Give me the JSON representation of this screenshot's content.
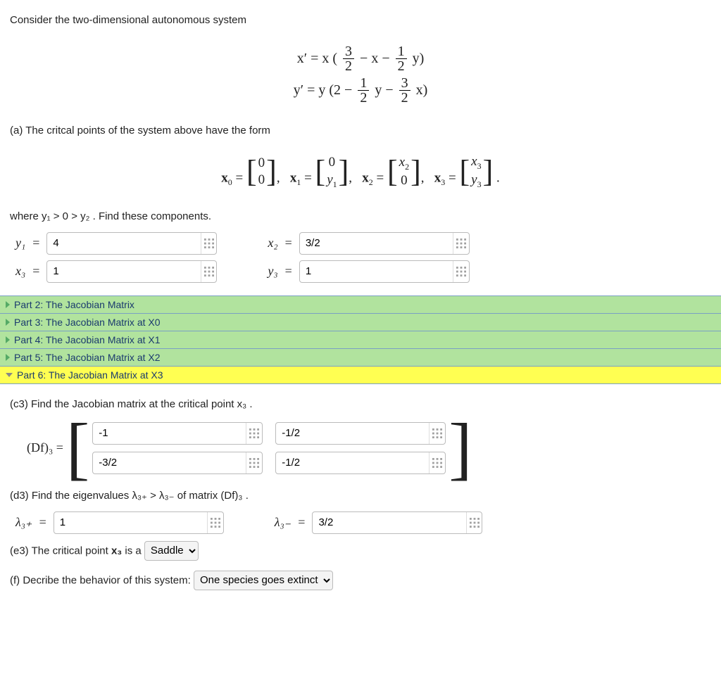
{
  "intro": "Consider the two-dimensional autonomous system",
  "equations": {
    "row1": {
      "lhs": "x′ = x (",
      "a_n": "3",
      "a_d": "2",
      "mid": " − x − ",
      "b_n": "1",
      "b_d": "2",
      "rhs": " y)"
    },
    "row2": {
      "lhs": "y′ = y (2 − ",
      "a_n": "1",
      "a_d": "2",
      "mid": " y − ",
      "b_n": "3",
      "b_d": "2",
      "rhs": " x)"
    }
  },
  "part_a": "(a) The critcal points of the system above have the form",
  "cp": {
    "x0l": "x",
    "x0s": "0",
    "eq": " = ",
    "comma": ", "
  },
  "cp_cells": {
    "zero": "0",
    "y1": "y",
    "y1s": "1",
    "x2": "x",
    "x2s": "2",
    "x3": "x",
    "x3s": "3",
    "y3": "y",
    "y3s": "3"
  },
  "where": "where y₁ > 0 > y₂ . Find these components.",
  "labels": {
    "y1": "y₁",
    "x2": "x₂",
    "x3": "x₃",
    "y3": "y₃",
    "l3p": "λ₃₊",
    "l3m": "λ₃₋",
    "Df": "(Df)₃ ="
  },
  "inputs": {
    "y1": "4",
    "x2": "3/2",
    "x3": "1",
    "y3": "1",
    "m11": "-1",
    "m12": "-1/2",
    "m21": "-3/2",
    "m22": "-1/2",
    "l3p": "1",
    "l3m": "3/2"
  },
  "parts": {
    "p2": "Part 2: The Jacobian Matrix",
    "p3": "Part 3: The Jacobian Matrix at X0",
    "p4": "Part 4: The Jacobian Matrix at X1",
    "p5": "Part 5: The Jacobian Matrix at X2",
    "p6": "Part 6: The Jacobian Matrix at X3"
  },
  "c3": "(c3) Find the Jacobian matrix at the critical point x₃ .",
  "d3": "(d3) Find the eigenvalues λ₃₊ > λ₃₋ of matrix (Df)₃ .",
  "e3_pre": "(e3) The critical point ",
  "e3_mid": "x₃",
  "e3_post": " is a",
  "f_pre": "(f) Decribe the behavior of this system:",
  "select_e3": "Saddle",
  "select_f": "One species goes extinct"
}
